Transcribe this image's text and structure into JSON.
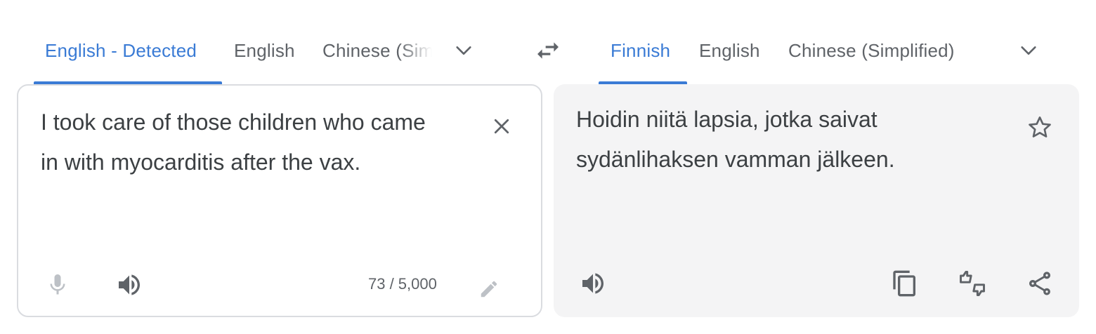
{
  "source_languages": {
    "tabs": [
      {
        "label": "English - Detected",
        "active": true
      },
      {
        "label": "English",
        "active": false
      },
      {
        "label": "Chinese (Simplified)",
        "active": false
      }
    ],
    "more_icon": "chevron-down-icon"
  },
  "swap_icon": "swap-arrows-icon",
  "target_languages": {
    "tabs": [
      {
        "label": "Finnish",
        "active": true
      },
      {
        "label": "English",
        "active": false
      },
      {
        "label": "Chinese (Simplified)",
        "active": false
      }
    ],
    "more_icon": "chevron-down-icon"
  },
  "source": {
    "text": "I took care of those children who came in with myocarditis after the vax.",
    "char_count": "73 / 5,000",
    "icons": [
      "close-icon",
      "microphone-icon",
      "speaker-icon",
      "pencil-icon"
    ]
  },
  "target": {
    "text": "Hoidin niitä lapsia, jotka saivat sydänlihaksen vamman jälkeen.",
    "icons": [
      "star-icon",
      "speaker-icon",
      "copy-icon",
      "feedback-icon",
      "share-icon"
    ]
  },
  "colors": {
    "accent": "#3a7bd5",
    "text": "#3c4043",
    "muted": "#5f6368",
    "target_bg": "#f4f4f5",
    "border": "#dadce0"
  }
}
